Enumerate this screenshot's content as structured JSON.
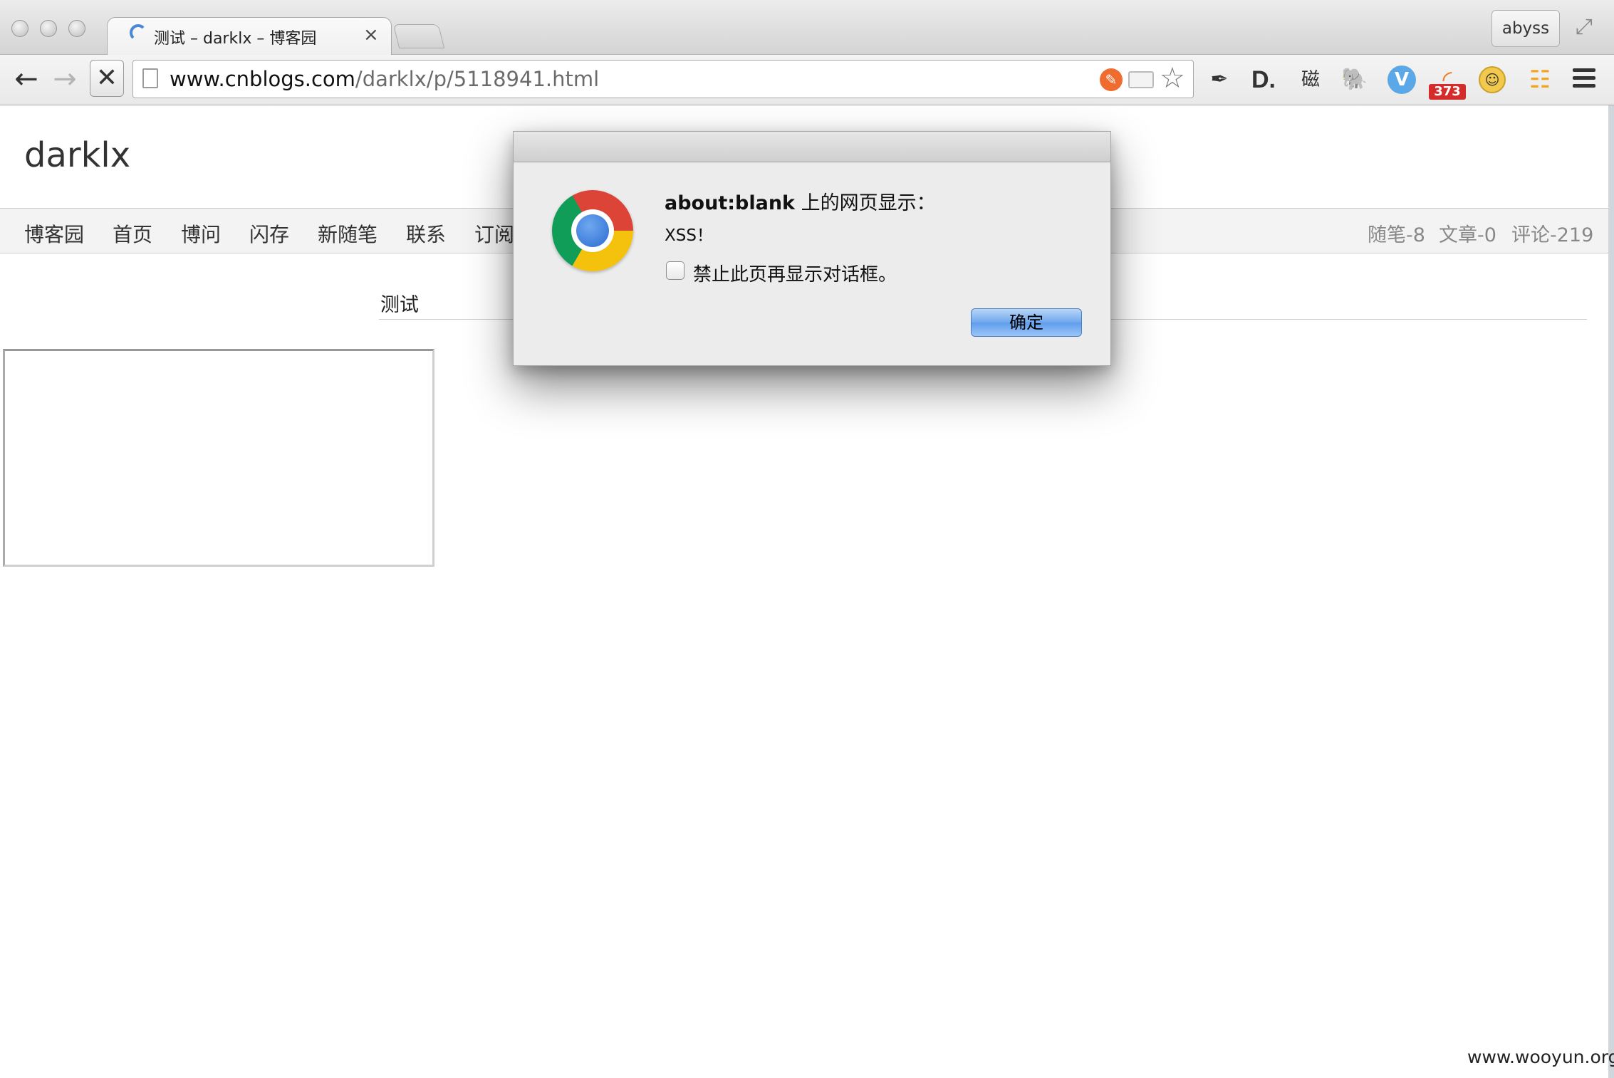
{
  "browser": {
    "tab_title": "测试 – darklx – 博客园",
    "tab_close": "×",
    "profile_name": "abyss",
    "url_host": "www.cnblogs.com",
    "url_path": "/darklx/p/5118941.html",
    "rss_count": "373",
    "extension_icons": [
      "pen-icon",
      "d-icon",
      "ci-icon",
      "evernote-icon",
      "v-icon",
      "rss-icon",
      "smiley-icon",
      "grid-icon"
    ]
  },
  "page": {
    "blog_title": "darklx",
    "nav": [
      "博客园",
      "首页",
      "博问",
      "闪存",
      "新随笔",
      "联系",
      "订阅"
    ],
    "stats": {
      "posts": "随笔-8",
      "articles": "文章-0",
      "comments": "评论-219"
    },
    "post_title": "测试"
  },
  "dialog": {
    "origin": "about:blank",
    "heading_suffix": " 上的网页显示：",
    "message": "XSS！",
    "suppress_label": "禁止此页再显示对话框。",
    "ok_label": "确定"
  },
  "watermark": "www.wooyun.org"
}
